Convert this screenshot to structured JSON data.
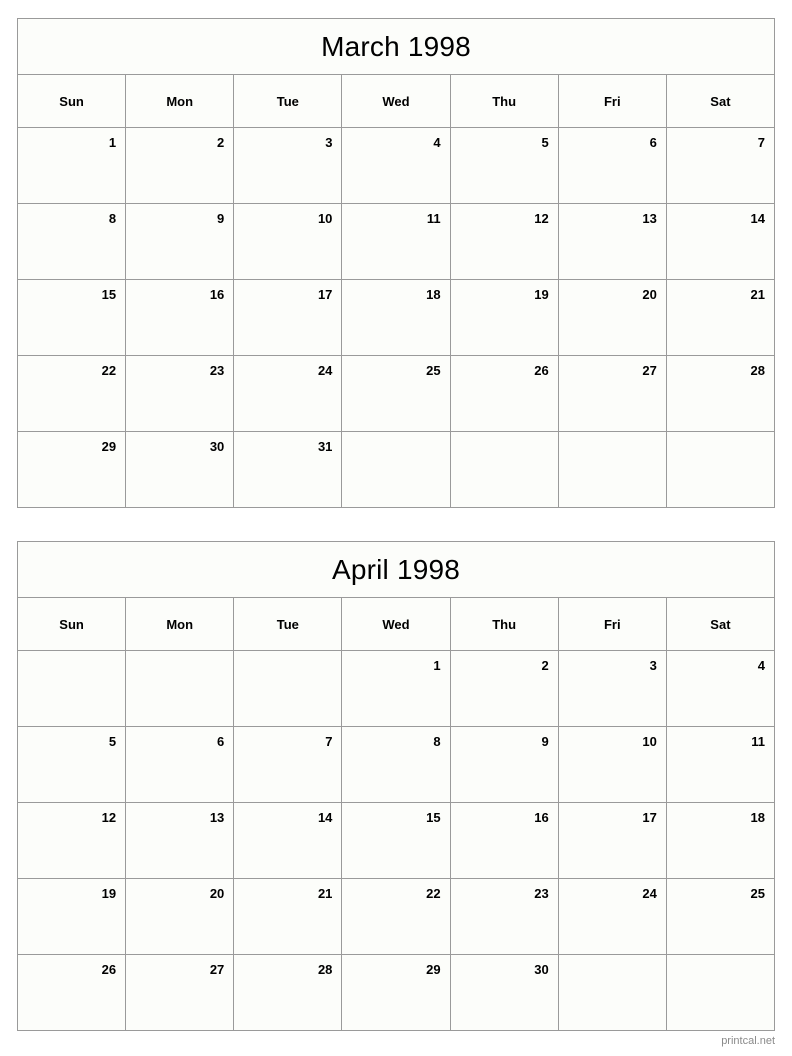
{
  "page": {
    "footer_text": "printcal.net",
    "grid_color": "#9a9a9a",
    "cell_background": "#fcfdfa",
    "text_color": "#000000",
    "footer_color": "#8a8a8a"
  },
  "months": [
    {
      "title": "March 1998",
      "weekdays": [
        "Sun",
        "Mon",
        "Tue",
        "Wed",
        "Thu",
        "Fri",
        "Sat"
      ],
      "weeks": [
        [
          "1",
          "2",
          "3",
          "4",
          "5",
          "6",
          "7"
        ],
        [
          "8",
          "9",
          "10",
          "11",
          "12",
          "13",
          "14"
        ],
        [
          "15",
          "16",
          "17",
          "18",
          "19",
          "20",
          "21"
        ],
        [
          "22",
          "23",
          "24",
          "25",
          "26",
          "27",
          "28"
        ],
        [
          "29",
          "30",
          "31",
          "",
          "",
          "",
          ""
        ]
      ]
    },
    {
      "title": "April 1998",
      "weekdays": [
        "Sun",
        "Mon",
        "Tue",
        "Wed",
        "Thu",
        "Fri",
        "Sat"
      ],
      "weeks": [
        [
          "",
          "",
          "",
          "1",
          "2",
          "3",
          "4"
        ],
        [
          "5",
          "6",
          "7",
          "8",
          "9",
          "10",
          "11"
        ],
        [
          "12",
          "13",
          "14",
          "15",
          "16",
          "17",
          "18"
        ],
        [
          "19",
          "20",
          "21",
          "22",
          "23",
          "24",
          "25"
        ],
        [
          "26",
          "27",
          "28",
          "29",
          "30",
          "",
          ""
        ]
      ]
    }
  ]
}
